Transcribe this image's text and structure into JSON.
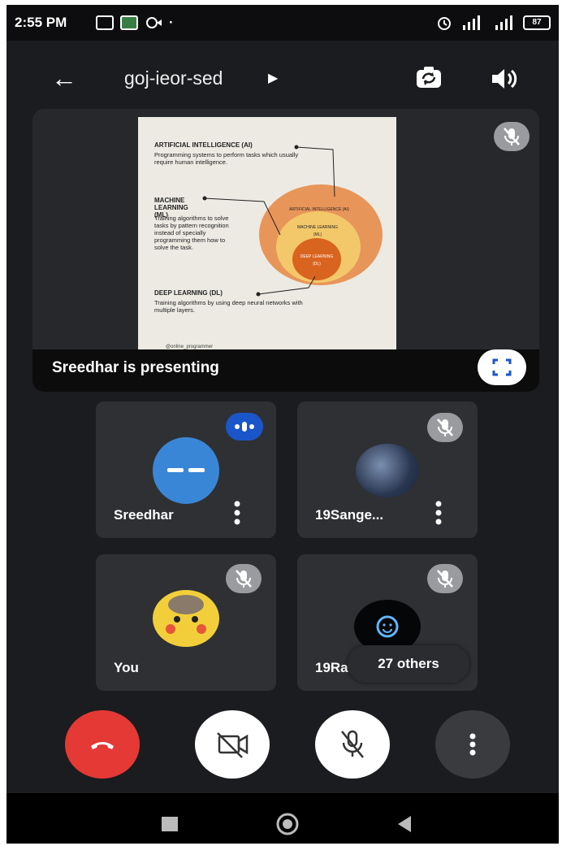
{
  "status": {
    "time": "2:55 PM",
    "battery": "87"
  },
  "meeting": {
    "title": "goj-ieor-sed"
  },
  "presentation": {
    "presenter_label": "Sreedhar is presenting",
    "slide": {
      "ai_heading": "ARTIFICIAL INTELLIGENCE (AI)",
      "ai_desc": "Programming systems to perform tasks which usually require human intelligence.",
      "ml_heading": "MACHINE LEARNING (ML)",
      "ml_desc": "Training algorithms to solve tasks by pattern recognition instead of specially programming them how to solve the task.",
      "dl_heading": "DEEP LEARNING (DL)",
      "dl_desc": "Training algorithms by using deep neural networks with multiple layers.",
      "outer_label": "ARTIFICIAL INTELLIGENCE (AI)",
      "middle_label": "MACHINE LEARNING (ML)",
      "inner_label": "DEEP LEARNING (DL)",
      "footer": "@online_programmer"
    }
  },
  "participants": [
    {
      "name": "Sreedhar",
      "state": "speaking"
    },
    {
      "name": "19Sange...",
      "state": "muted"
    },
    {
      "name": "You",
      "state": "muted"
    },
    {
      "name": "19Ra",
      "state": "muted"
    }
  ],
  "others": "27 others",
  "controls": [
    "end-call",
    "camera-off",
    "mic-off",
    "more-options"
  ],
  "colors": {
    "end_call": "#e53935",
    "speaking_badge": "#1a56c9",
    "tile_bg": "#2f3033",
    "background": "#1b1c1f"
  }
}
